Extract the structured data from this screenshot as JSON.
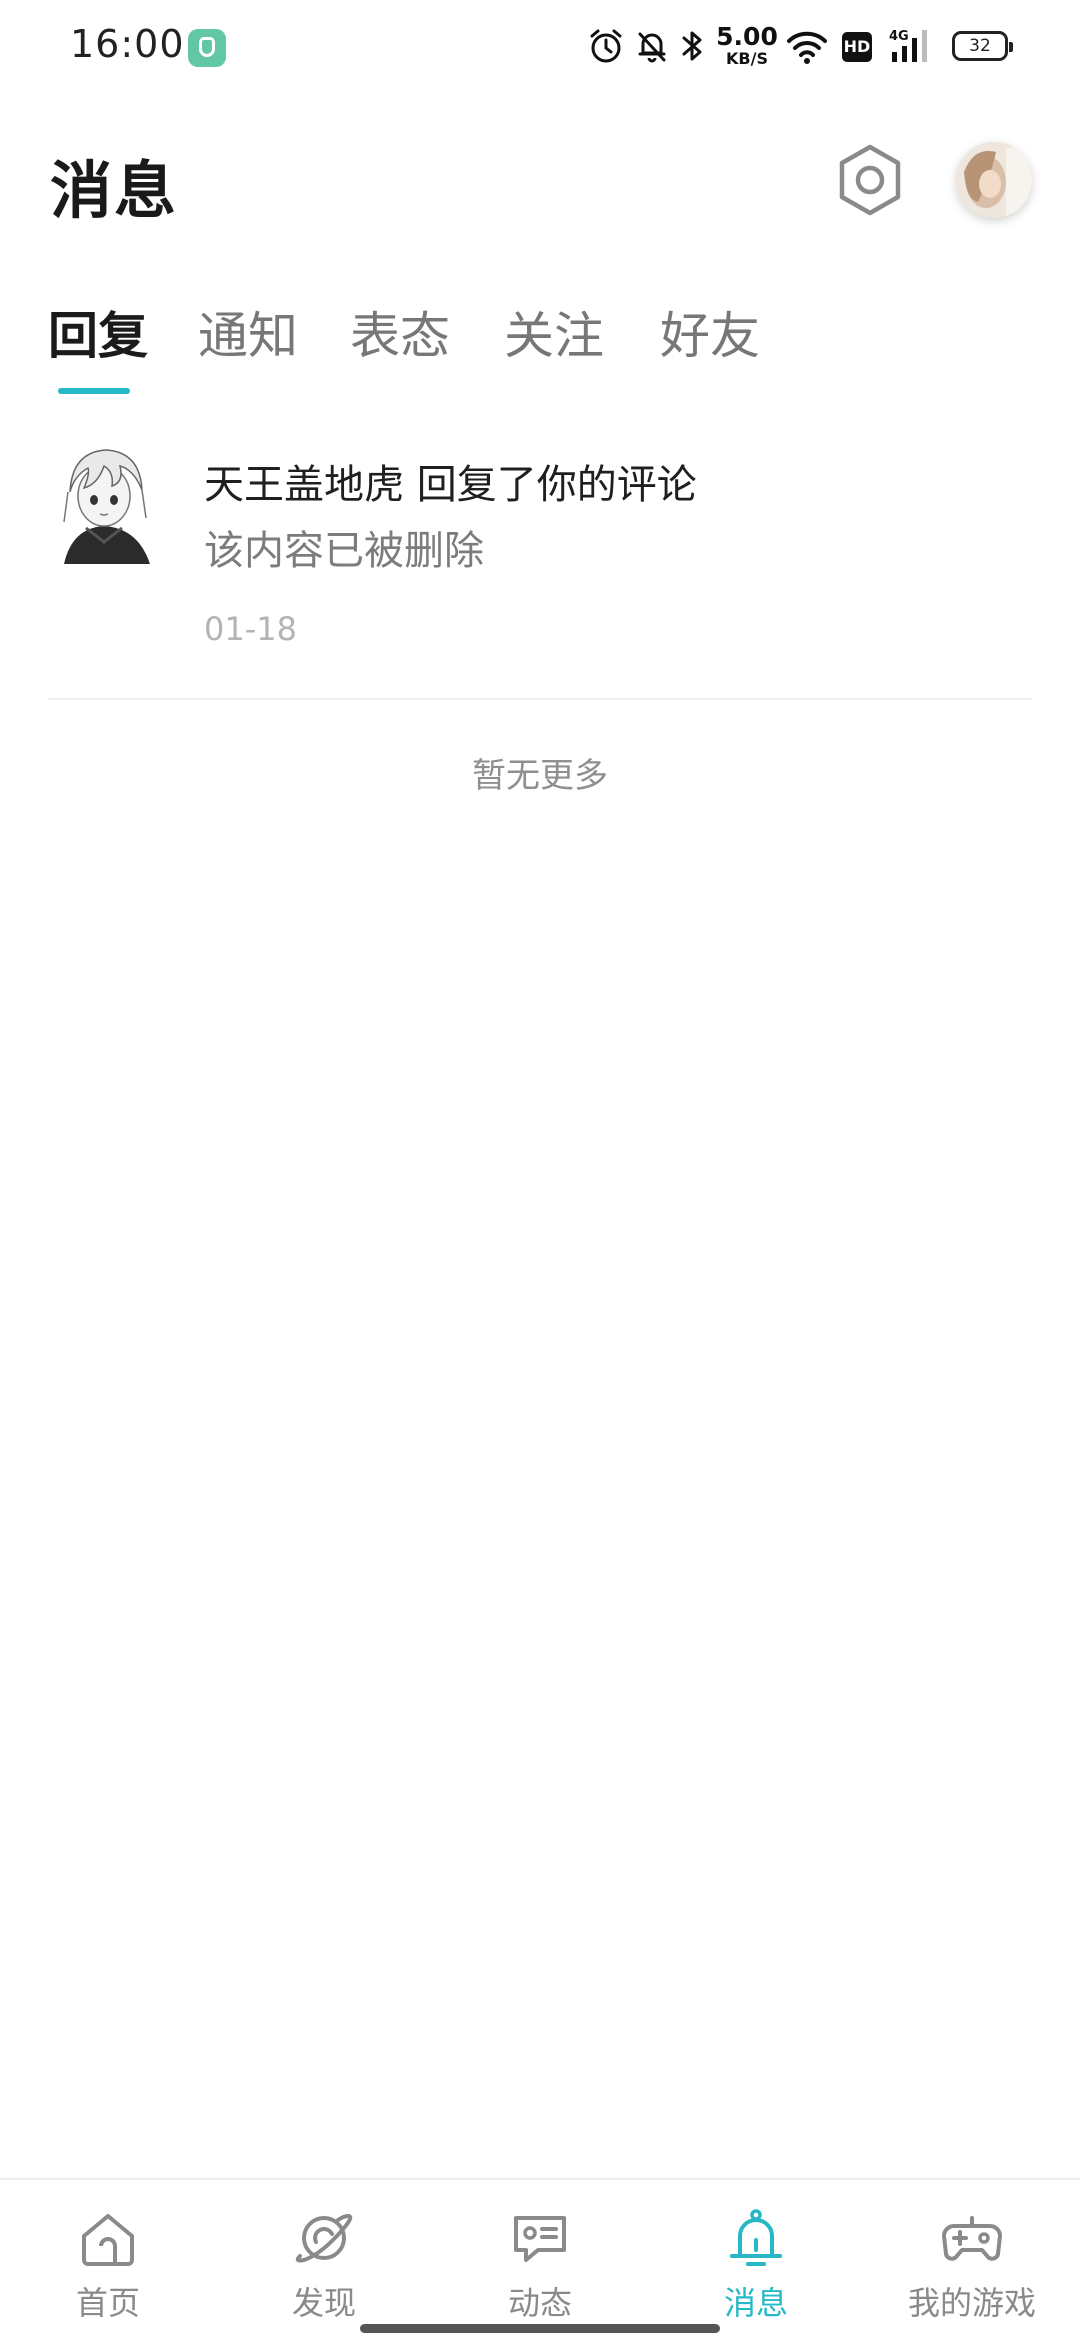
{
  "status_bar": {
    "time": "16:00",
    "net_speed_value": "5.00",
    "net_speed_unit": "KB/S",
    "hd_label": "HD",
    "signal_label": "4G",
    "battery": "32"
  },
  "header": {
    "title": "消息"
  },
  "tabs": [
    {
      "label": "回复",
      "active": true
    },
    {
      "label": "通知",
      "active": false
    },
    {
      "label": "表态",
      "active": false
    },
    {
      "label": "关注",
      "active": false
    },
    {
      "label": "好友",
      "active": false
    }
  ],
  "messages": [
    {
      "title": "天王盖地虎 回复了你的评论",
      "content": "该内容已被删除",
      "date": "01-18"
    }
  ],
  "list_footer": "暂无更多",
  "bottom_nav": [
    {
      "label": "首页",
      "icon": "home-icon",
      "active": false
    },
    {
      "label": "发现",
      "icon": "planet-icon",
      "active": false
    },
    {
      "label": "动态",
      "icon": "chat-card-icon",
      "active": false
    },
    {
      "label": "消息",
      "icon": "bell-icon",
      "active": true
    },
    {
      "label": "我的游戏",
      "icon": "gamepad-icon",
      "active": false
    }
  ],
  "colors": {
    "accent": "#27b8c6",
    "text_primary": "#1f1f1f",
    "text_secondary": "#7c7c7c",
    "text_muted": "#b3b3b3"
  }
}
